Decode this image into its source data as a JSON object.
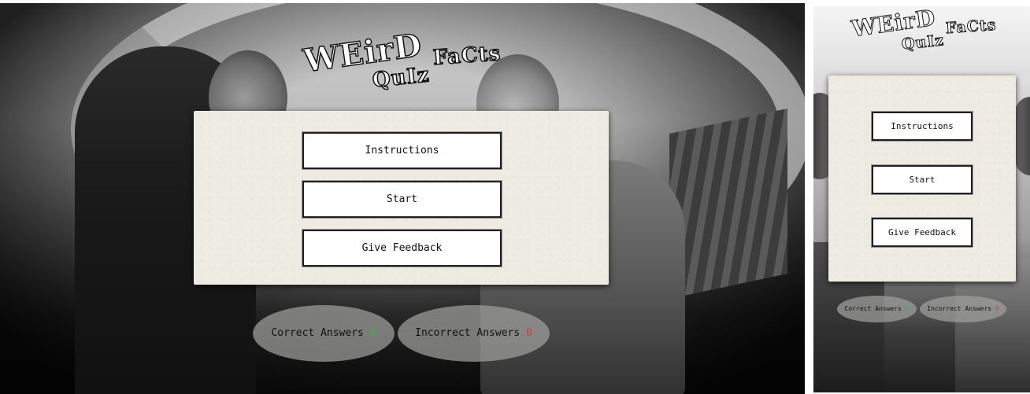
{
  "app": {
    "logo": {
      "word1": "WEirD",
      "word2": "FaCts",
      "word3": "QuIz"
    }
  },
  "menu": {
    "instructions_label": "Instructions",
    "start_label": "Start",
    "feedback_label": "Give Feedback"
  },
  "scores": {
    "correct_label": "Correct Answers",
    "correct_value": "0",
    "incorrect_label": "Incorrect Answers",
    "incorrect_value": "0"
  },
  "colors": {
    "correct": "#2fbf2f",
    "incorrect": "#e23a3a",
    "panel": "#eeebe3"
  }
}
